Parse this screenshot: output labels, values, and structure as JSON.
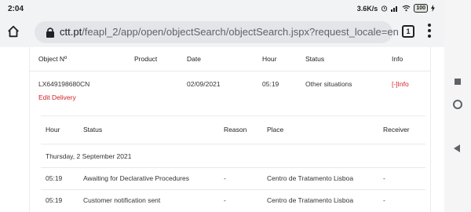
{
  "status_bar": {
    "time": "2:04",
    "net_speed": "3.6K/s",
    "battery": "100"
  },
  "browser": {
    "url_host": "ctt.pt",
    "url_path": "/feapl_2/app/open/objectSearch/objectSearch.jspx?request_locale=en",
    "tab_count": "1"
  },
  "object_table": {
    "headers": {
      "object": "Object Nº",
      "product": "Product",
      "date": "Date",
      "hour": "Hour",
      "status": "Status",
      "info": "Info"
    },
    "row": {
      "object_number": "LX649198680CN",
      "product": "",
      "date": "02/09/2021",
      "hour": "05:19",
      "status": "Other situations",
      "info_link": "[-]Info",
      "edit_link": "Edit Delivery"
    }
  },
  "events_table": {
    "headers": {
      "hour": "Hour",
      "status": "Status",
      "reason": "Reason",
      "place": "Place",
      "receiver": "Receiver"
    },
    "day_label": "Thursday, 2 September 2021",
    "rows": [
      {
        "hour": "05:19",
        "status": "Awaiting for Declarative Procedures",
        "reason": "-",
        "place": "Centro de Tratamento Lisboa",
        "receiver": "-"
      },
      {
        "hour": "05:19",
        "status": "Customer notification sent",
        "reason": "-",
        "place": "Centro de Tratamento Lisboa",
        "receiver": "-"
      }
    ]
  },
  "colors": {
    "link_red": "#d2232a",
    "chrome_bg": "#f1f3f4"
  }
}
